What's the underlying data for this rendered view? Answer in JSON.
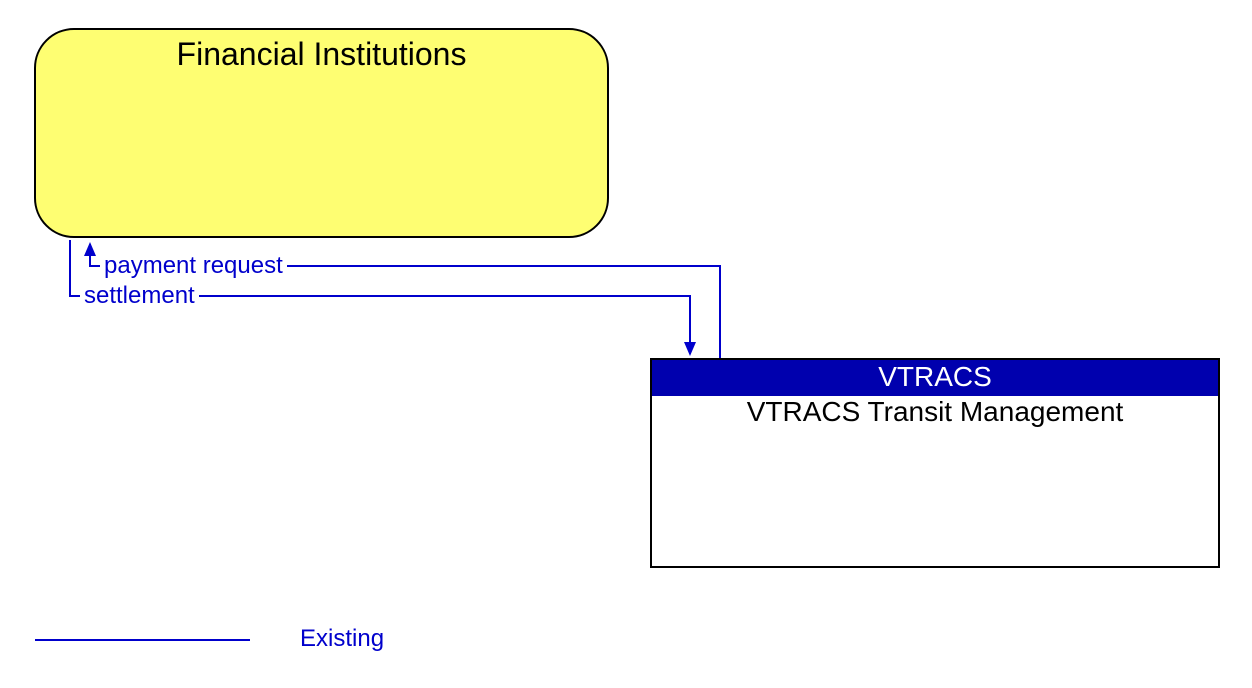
{
  "nodes": {
    "financial": {
      "title": "Financial Institutions"
    },
    "vtracs": {
      "header": "VTRACS",
      "subtitle": "VTRACS Transit Management"
    }
  },
  "flows": {
    "payment_request": "payment request",
    "settlement": "settlement"
  },
  "legend": {
    "existing": "Existing"
  },
  "colors": {
    "flow_line": "#0000CC",
    "node_financial_fill": "#FEFE72",
    "node_vtracs_header": "#0000AE"
  }
}
